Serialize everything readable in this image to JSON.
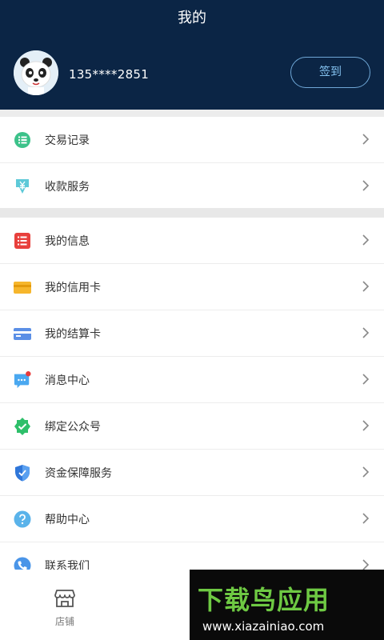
{
  "header": {
    "title": "我的",
    "phone": "135****2851",
    "checkin_label": "签到"
  },
  "group1": [
    {
      "label": "交易记录",
      "icon": "list-icon"
    },
    {
      "label": "收款服务",
      "icon": "yen-download-icon"
    }
  ],
  "group2": [
    {
      "label": "我的信息",
      "icon": "info-list-icon"
    },
    {
      "label": "我的信用卡",
      "icon": "credit-card-icon"
    },
    {
      "label": "我的结算卡",
      "icon": "settlement-card-icon"
    },
    {
      "label": "消息中心",
      "icon": "message-icon"
    },
    {
      "label": "绑定公众号",
      "icon": "verified-badge-icon"
    },
    {
      "label": "资金保障服务",
      "icon": "shield-icon"
    },
    {
      "label": "帮助中心",
      "icon": "help-icon"
    },
    {
      "label": "联系我们",
      "icon": "phone-icon"
    }
  ],
  "bottom_nav": {
    "store_label": "店铺"
  },
  "watermark": {
    "title": "下载鸟应用",
    "url": "www.xiazainiao.com"
  },
  "colors": {
    "header_bg": "#0b2545",
    "accent_green": "#6ec943"
  }
}
